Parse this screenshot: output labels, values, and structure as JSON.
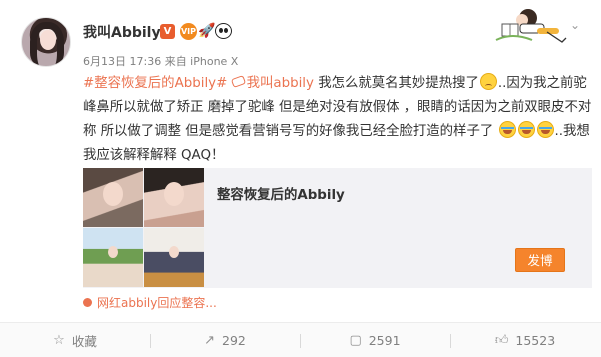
{
  "post": {
    "username": "我叫Abbily",
    "verified_badge": "V",
    "vip_badge": "VIP",
    "meta": "6月13日 17:36 来自 iPhone X",
    "content": {
      "topic": "#整容恢复后的Abbily#",
      "mention": "我叫abbily",
      "text1": " 我怎么就莫名其妙提热搜了",
      "text2": "..因为我之前驼峰鼻所以就做了矫正 磨掉了驼峰 但是绝对没有放假体 ，眼睛的话因为之前双眼皮不对称 所以做了调整 但是感觉看营销号写的好像我已经全脸打造的样子了",
      "text3": "..我想我应该解释解释 QAQ！"
    },
    "media": {
      "title": "整容恢复后的Abbily",
      "send_button": "发博",
      "video_link": "网红abbily回应整容..."
    }
  },
  "actions": {
    "favorite": "收藏",
    "repost_count": "292",
    "comment_count": "2591",
    "like_count": "15523"
  },
  "icons": {
    "favorite": "star-icon",
    "repost": "repost-icon",
    "comment": "comment-icon",
    "like": "thumbs-up-icon"
  },
  "colors": {
    "accent": "#eb7350",
    "button": "#f5842c"
  }
}
